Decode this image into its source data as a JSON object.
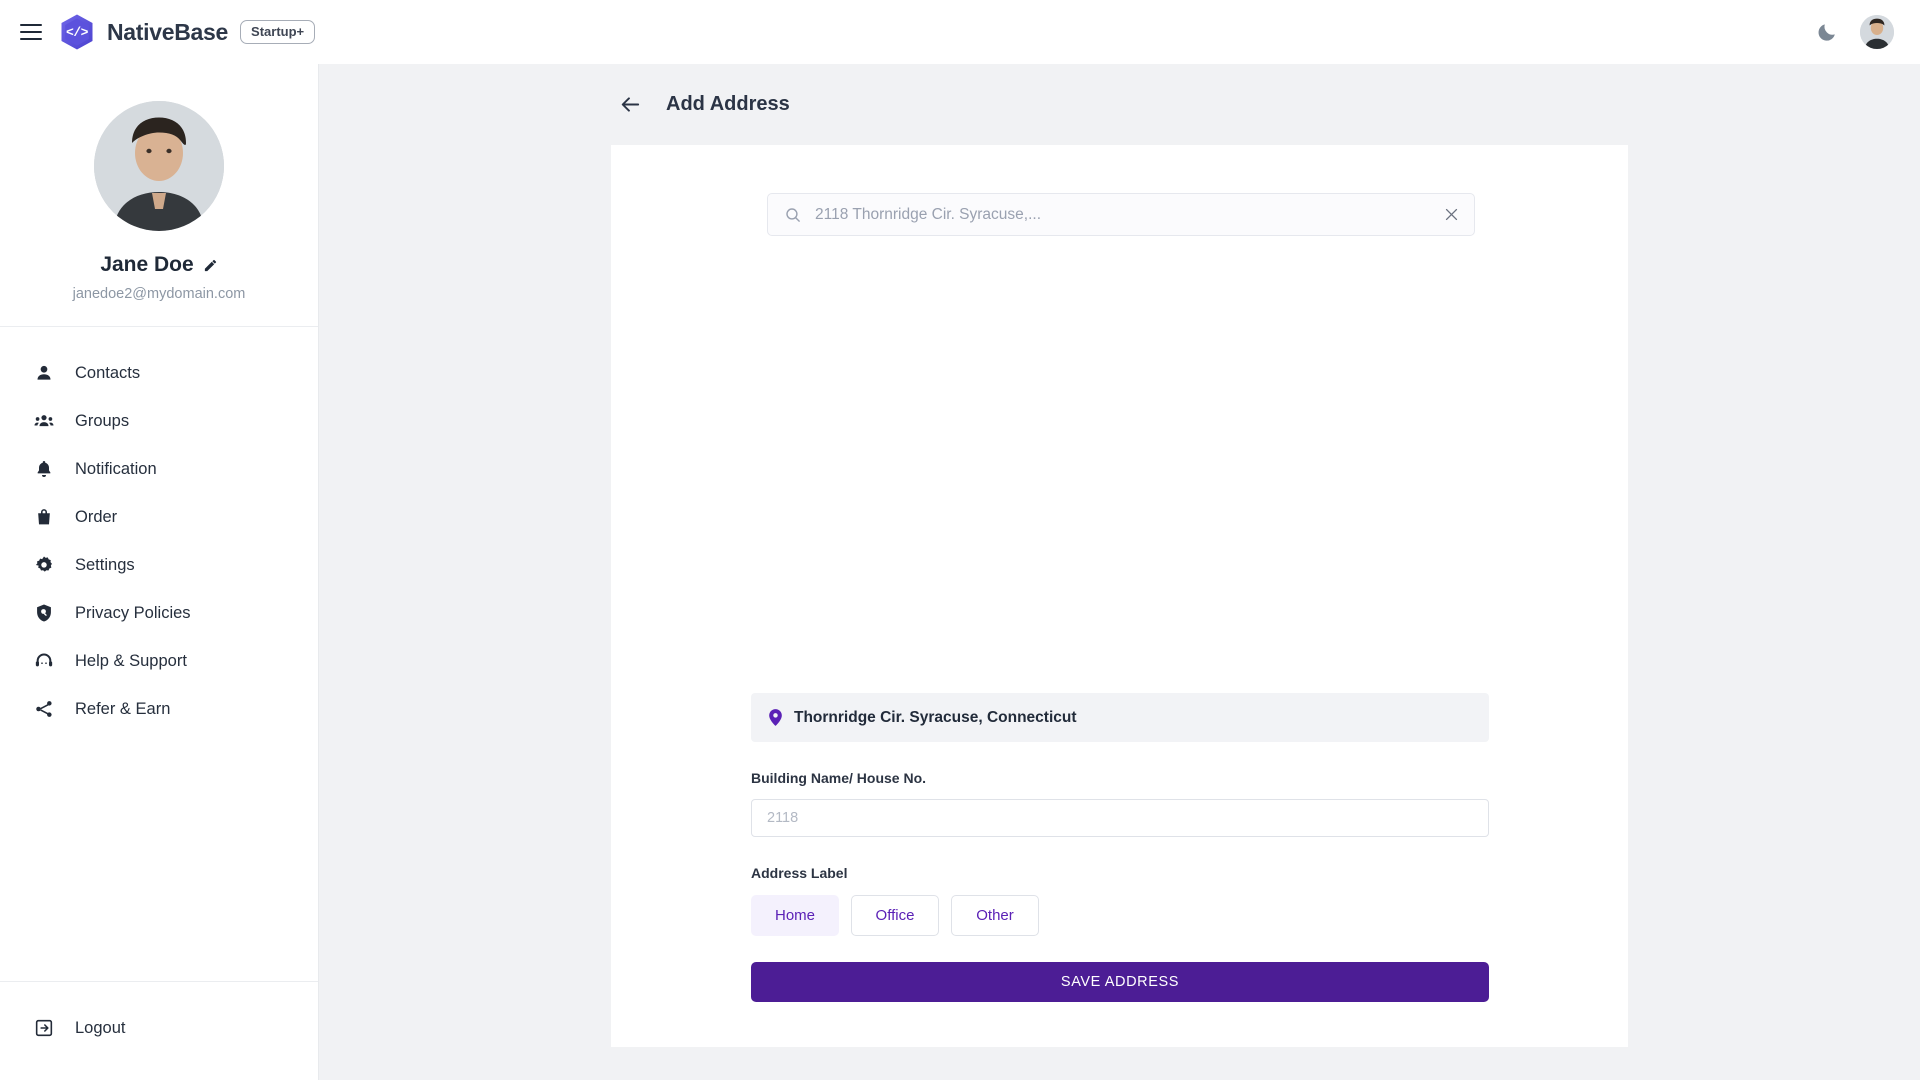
{
  "topbar": {
    "menu_icon": "hamburger-menu-icon",
    "logo_glyph": "</>",
    "logo_icon": "nativebase-hexagon-logo",
    "brand": "NativeBase",
    "badge": "Startup+",
    "theme_toggle_icon": "moon-icon",
    "avatar_icon": "user-avatar"
  },
  "sidebar": {
    "profile": {
      "name": "Jane Doe",
      "email": "janedoe2@mydomain.com",
      "edit_icon": "pencil-icon",
      "avatar_icon": "profile-avatar"
    },
    "items": [
      {
        "label": "Contacts",
        "icon": "person-icon"
      },
      {
        "label": "Groups",
        "icon": "people-group-icon"
      },
      {
        "label": "Notification",
        "icon": "bell-icon"
      },
      {
        "label": "Order",
        "icon": "shopping-bag-icon"
      },
      {
        "label": "Settings",
        "icon": "gear-icon"
      },
      {
        "label": "Privacy Policies",
        "icon": "shield-search-icon"
      },
      {
        "label": "Help & Support",
        "icon": "headset-icon"
      },
      {
        "label": "Refer & Earn",
        "icon": "share-icon"
      }
    ],
    "logout": {
      "label": "Logout",
      "icon": "logout-icon"
    }
  },
  "main": {
    "back_icon": "arrow-left-icon",
    "title": "Add Address",
    "search": {
      "value": "",
      "placeholder": "2118 Thornridge Cir. Syracuse,...",
      "search_icon": "search-icon",
      "clear_icon": "close-x-icon"
    },
    "address_pill": {
      "text": "Thornridge Cir. Syracuse, Connecticut",
      "icon": "map-pin-icon"
    },
    "building_field": {
      "label": "Building Name/ House No.",
      "value": "",
      "placeholder": "2118"
    },
    "address_label": {
      "label": "Address Label",
      "options": [
        "Home",
        "Office",
        "Other"
      ],
      "selected": "Home"
    },
    "save_button": "SAVE ADDRESS"
  },
  "colors": {
    "brand_purple": "#4c1d95",
    "accent_indigo": "#5a55d6",
    "chip_text": "#5b21b6",
    "chip_selected_bg": "#f4f1fd",
    "page_bg": "#f1f2f4",
    "surface": "#ffffff"
  }
}
